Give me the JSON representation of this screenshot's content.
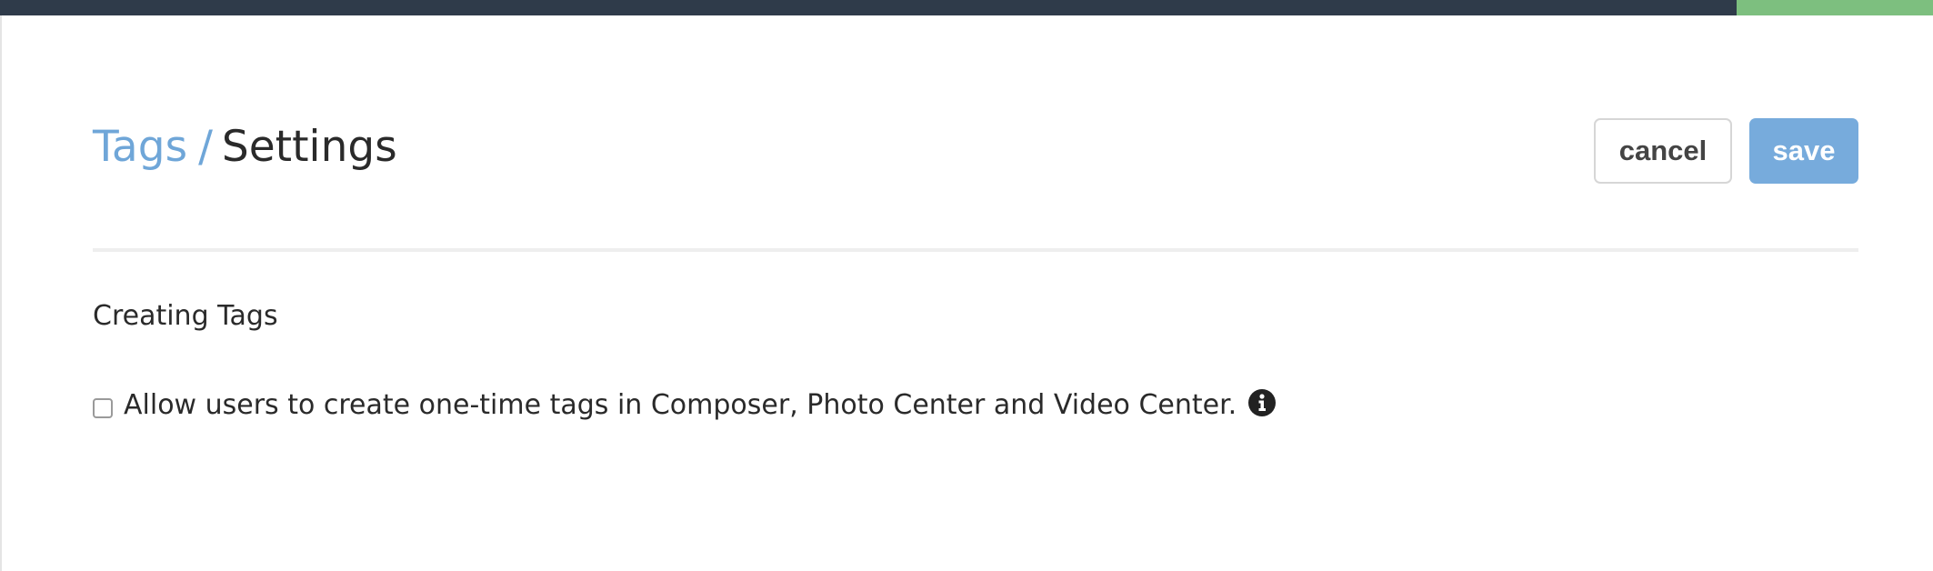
{
  "colors": {
    "top_bar": "#2f3b4a",
    "top_bar_accent": "#7dbf7f",
    "link": "#6fa6d8",
    "save_button": "#77abdc"
  },
  "breadcrumb": {
    "parent": "Tags",
    "separator": "/",
    "current": "Settings"
  },
  "actions": {
    "cancel_label": "cancel",
    "save_label": "save"
  },
  "section": {
    "title": "Creating Tags"
  },
  "option": {
    "label": "Allow users to create one-time tags in Composer, Photo Center and Video Center.",
    "checked": false,
    "info_icon": "info-circle-icon"
  }
}
